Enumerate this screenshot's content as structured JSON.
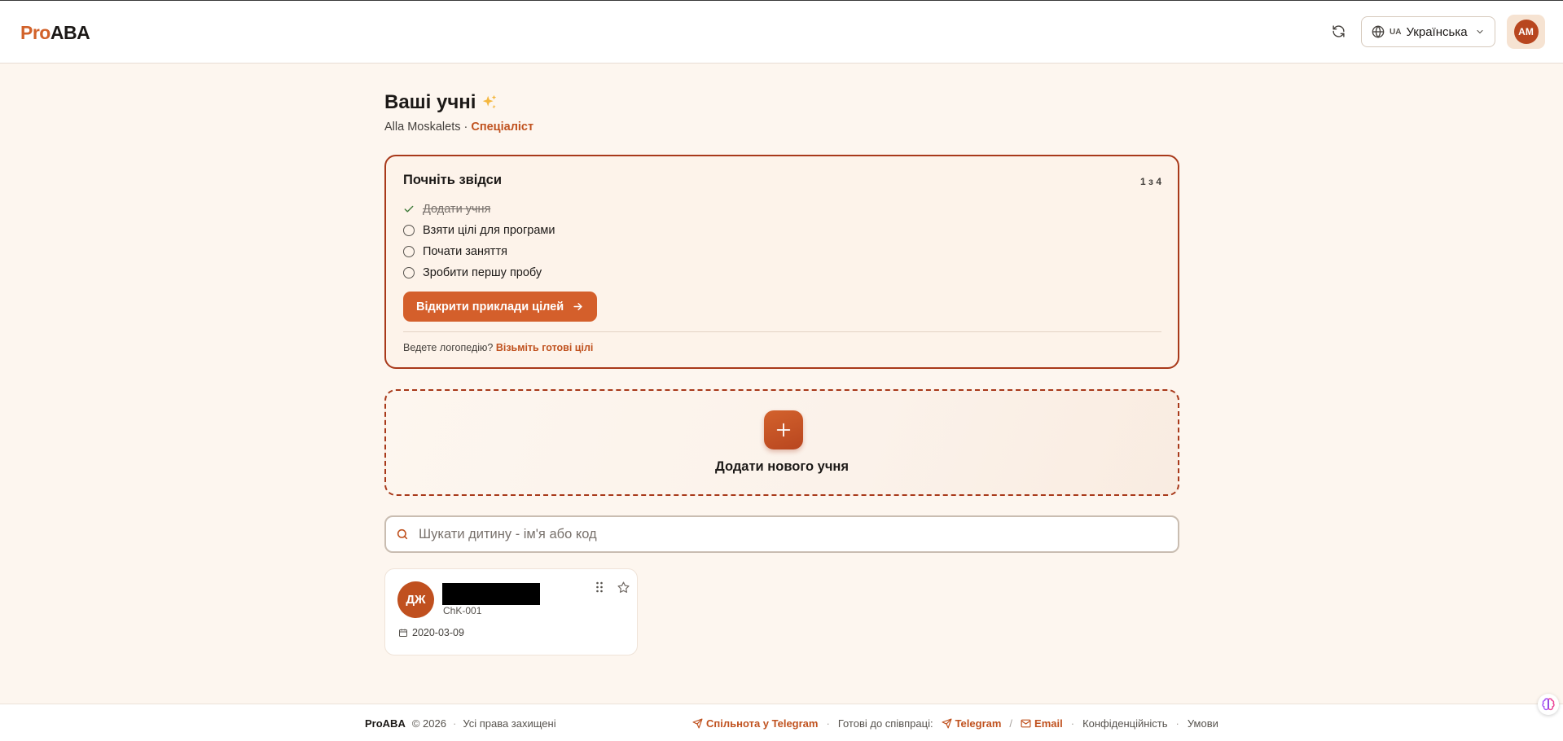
{
  "header": {
    "logo_pro": "Pro",
    "logo_aba": "ABA",
    "language_code": "UA",
    "language_label": "Українська",
    "avatar_initials": "AM"
  },
  "page": {
    "title": "Ваші учні",
    "user_name": "Alla Moskalets",
    "separator": "·",
    "user_role": "Спеціаліст"
  },
  "onboarding": {
    "title": "Почніть звідси",
    "progress": "1 з 4",
    "steps": [
      {
        "label": "Додати учня",
        "done": true
      },
      {
        "label": "Взяти цілі для програми",
        "done": false
      },
      {
        "label": "Почати заняття",
        "done": false
      },
      {
        "label": "Зробити першу пробу",
        "done": false
      }
    ],
    "cta_label": "Відкрити приклади цілей",
    "note_text": "Ведете логопедію?",
    "note_link": "Візьміть готові цілі"
  },
  "add_student": {
    "label": "Додати нового учня"
  },
  "search": {
    "placeholder": "Шукати дитину - ім'я або код",
    "value": ""
  },
  "students": [
    {
      "initials": "ДЖ",
      "code": "ChK-001",
      "date": "2020-03-09"
    }
  ],
  "footer": {
    "brand": "ProABA",
    "copyright": "© 2026",
    "rights": "Усі права захищені",
    "telegram_community": "Спільнота у Telegram",
    "cooperation": "Готові до співпраці:",
    "telegram": "Telegram",
    "slash": "/",
    "email": "Email",
    "privacy": "Конфіденційність",
    "terms": "Умови"
  },
  "colors": {
    "accent": "#d45f2b",
    "border_accent": "#a8391a",
    "background": "#fdf6ef"
  }
}
